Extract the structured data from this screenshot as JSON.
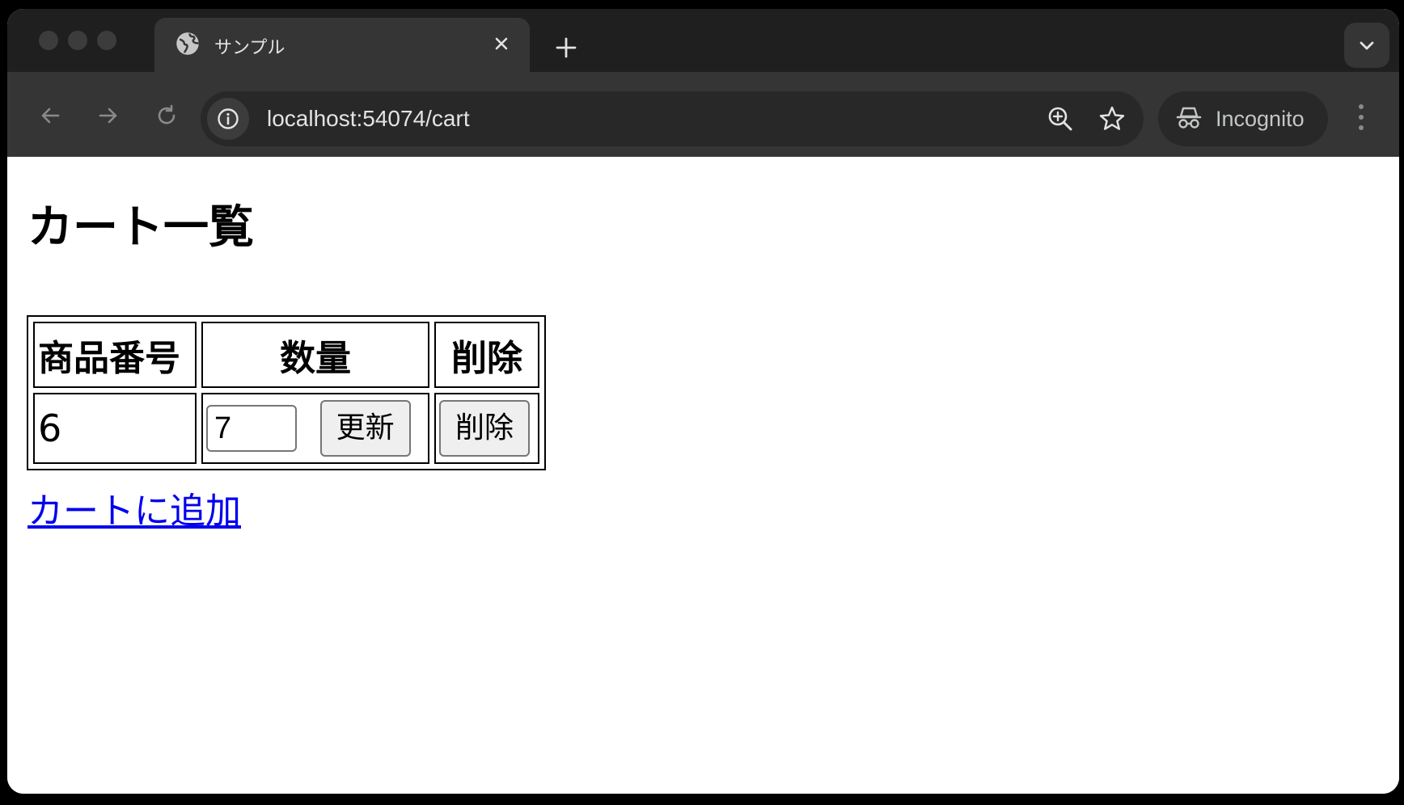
{
  "browser": {
    "tab": {
      "title": "サンプル",
      "icon": "globe-icon"
    },
    "address_bar": {
      "url": "localhost:54074/cart"
    },
    "profile": {
      "label": "Incognito"
    }
  },
  "page": {
    "title": "カート一覧",
    "table": {
      "headers": [
        "商品番号",
        "数量",
        "削除"
      ],
      "rows": [
        {
          "product_id": "6",
          "quantity": "7",
          "update_label": "更新",
          "delete_label": "削除"
        }
      ]
    },
    "add_link": "カートに追加"
  },
  "colors": {
    "chrome_dark": "#1f1f1f",
    "toolbar": "#353535",
    "link": "#0000ee"
  }
}
